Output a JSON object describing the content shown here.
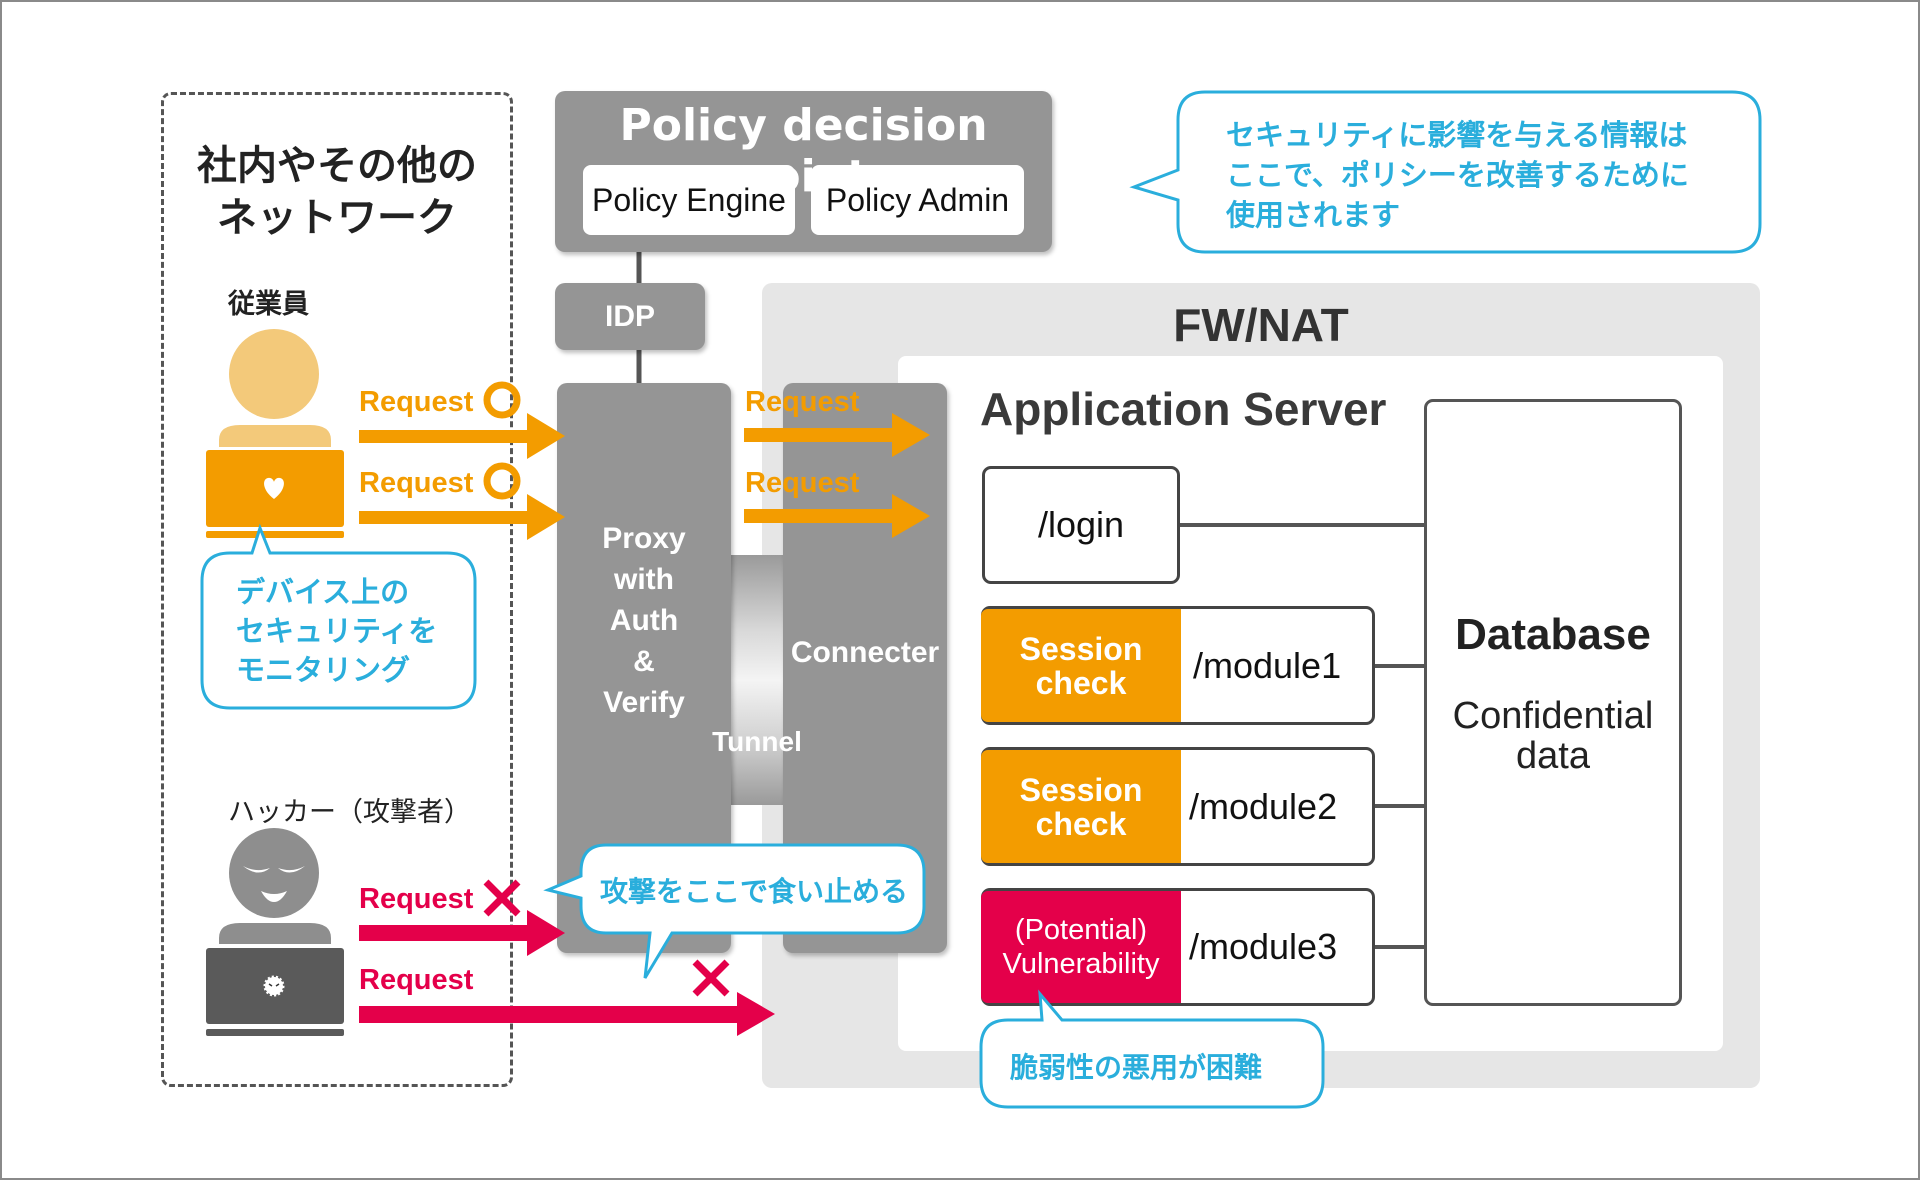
{
  "colors": {
    "orange": "#f39c00",
    "skin": "#f3c97a",
    "crimson": "#e4004a",
    "gray_box": "#959595",
    "fw_gray": "#e6e6e6",
    "bubble_blue": "#2aaedc",
    "dark_text": "#222222"
  },
  "network_zone": {
    "title_line1": "社内やその他の",
    "title_line2": "ネットワーク",
    "employee": {
      "label": "従業員",
      "laptop_icon": "heart-icon",
      "requests": [
        {
          "label": "Request",
          "status": "allowed",
          "status_icon": "circle-ok-icon"
        },
        {
          "label": "Request",
          "status": "allowed",
          "status_icon": "circle-ok-icon"
        }
      ],
      "bubble": [
        "デバイス上の",
        "セキュリティを",
        "モニタリング"
      ]
    },
    "hacker": {
      "label": "ハッカー（攻撃者）",
      "laptop_icon": "virus-icon",
      "requests": [
        {
          "label": "Request",
          "status": "blocked",
          "status_icon": "x-icon"
        },
        {
          "label": "Request",
          "status": "blocked",
          "status_icon": "x-icon"
        }
      ]
    }
  },
  "policy_decision_point": {
    "title": "Policy decision point",
    "engine": "Policy Engine",
    "admin": "Policy Admin",
    "bubble": [
      "セキュリティに影響を与える情報は",
      "ここで、ポリシーを改善するために",
      "使用されます"
    ]
  },
  "idp": {
    "label": "IDP"
  },
  "proxy": {
    "lines": [
      "Proxy",
      "with",
      "Auth",
      "&",
      "Verify"
    ]
  },
  "tunnel": {
    "label": "Tunnel"
  },
  "connector": {
    "label": "Connecter",
    "requests": [
      {
        "label": "Request"
      },
      {
        "label": "Request"
      }
    ]
  },
  "attack_bubble": {
    "text": "攻撃をここで食い止める"
  },
  "fw": {
    "title": "FW/NAT"
  },
  "app_server": {
    "title": "Application Server",
    "login": "/login",
    "modules": [
      {
        "check_line1": "Session",
        "check_line2": "check",
        "route": "/module1",
        "kind": "session"
      },
      {
        "check_line1": "Session",
        "check_line2": "check",
        "route": "/module2",
        "kind": "session"
      },
      {
        "check_line1": "(Potential)",
        "check_line2": "Vulnerability",
        "route": "/module3",
        "kind": "vulnerability"
      }
    ],
    "vuln_bubble": "脆弱性の悪用が困難"
  },
  "database": {
    "title": "Database",
    "sub_line1": "Confidential",
    "sub_line2": "data"
  }
}
